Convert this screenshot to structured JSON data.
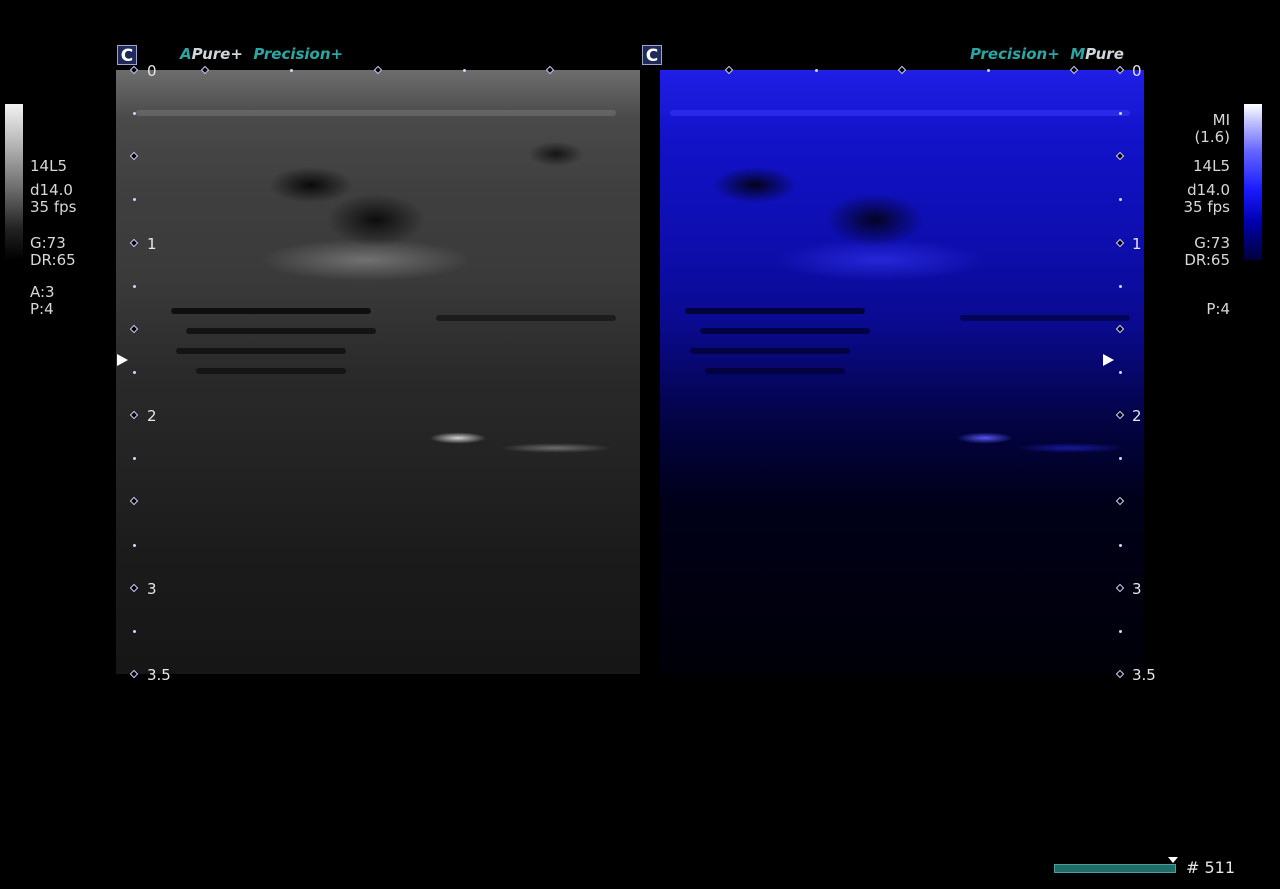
{
  "left_panel": {
    "badge": "C",
    "mode_a": "A",
    "mode_pure": "Pure+",
    "mode_precision": "Precision+",
    "info": {
      "probe": "14L5",
      "depth": "d14.0",
      "fps": "35 fps",
      "gain": "G:73",
      "dr": "DR:65",
      "a": "A:3",
      "p": "P:4"
    }
  },
  "right_panel": {
    "badge": "C",
    "mode_precision": "Precision+",
    "mode_m": "M",
    "mode_pure": "Pure",
    "info": {
      "mi": "MI",
      "mi_value": "(1.6)",
      "probe": "14L5",
      "depth": "d14.0",
      "fps": "35 fps",
      "gain": "G:73",
      "dr": "DR:65",
      "p": "P:4"
    }
  },
  "depth_scale": {
    "labels": [
      "0",
      "1",
      "2",
      "3",
      "3.5"
    ]
  },
  "cine": {
    "frame": "# 511",
    "position": 0.94
  },
  "colors": {
    "mode_accent": "#2aa7a3",
    "tint_right": "#1a1aff"
  },
  "icons": {
    "focus": "triangle-right-icon",
    "tick": "diamond-icon"
  }
}
